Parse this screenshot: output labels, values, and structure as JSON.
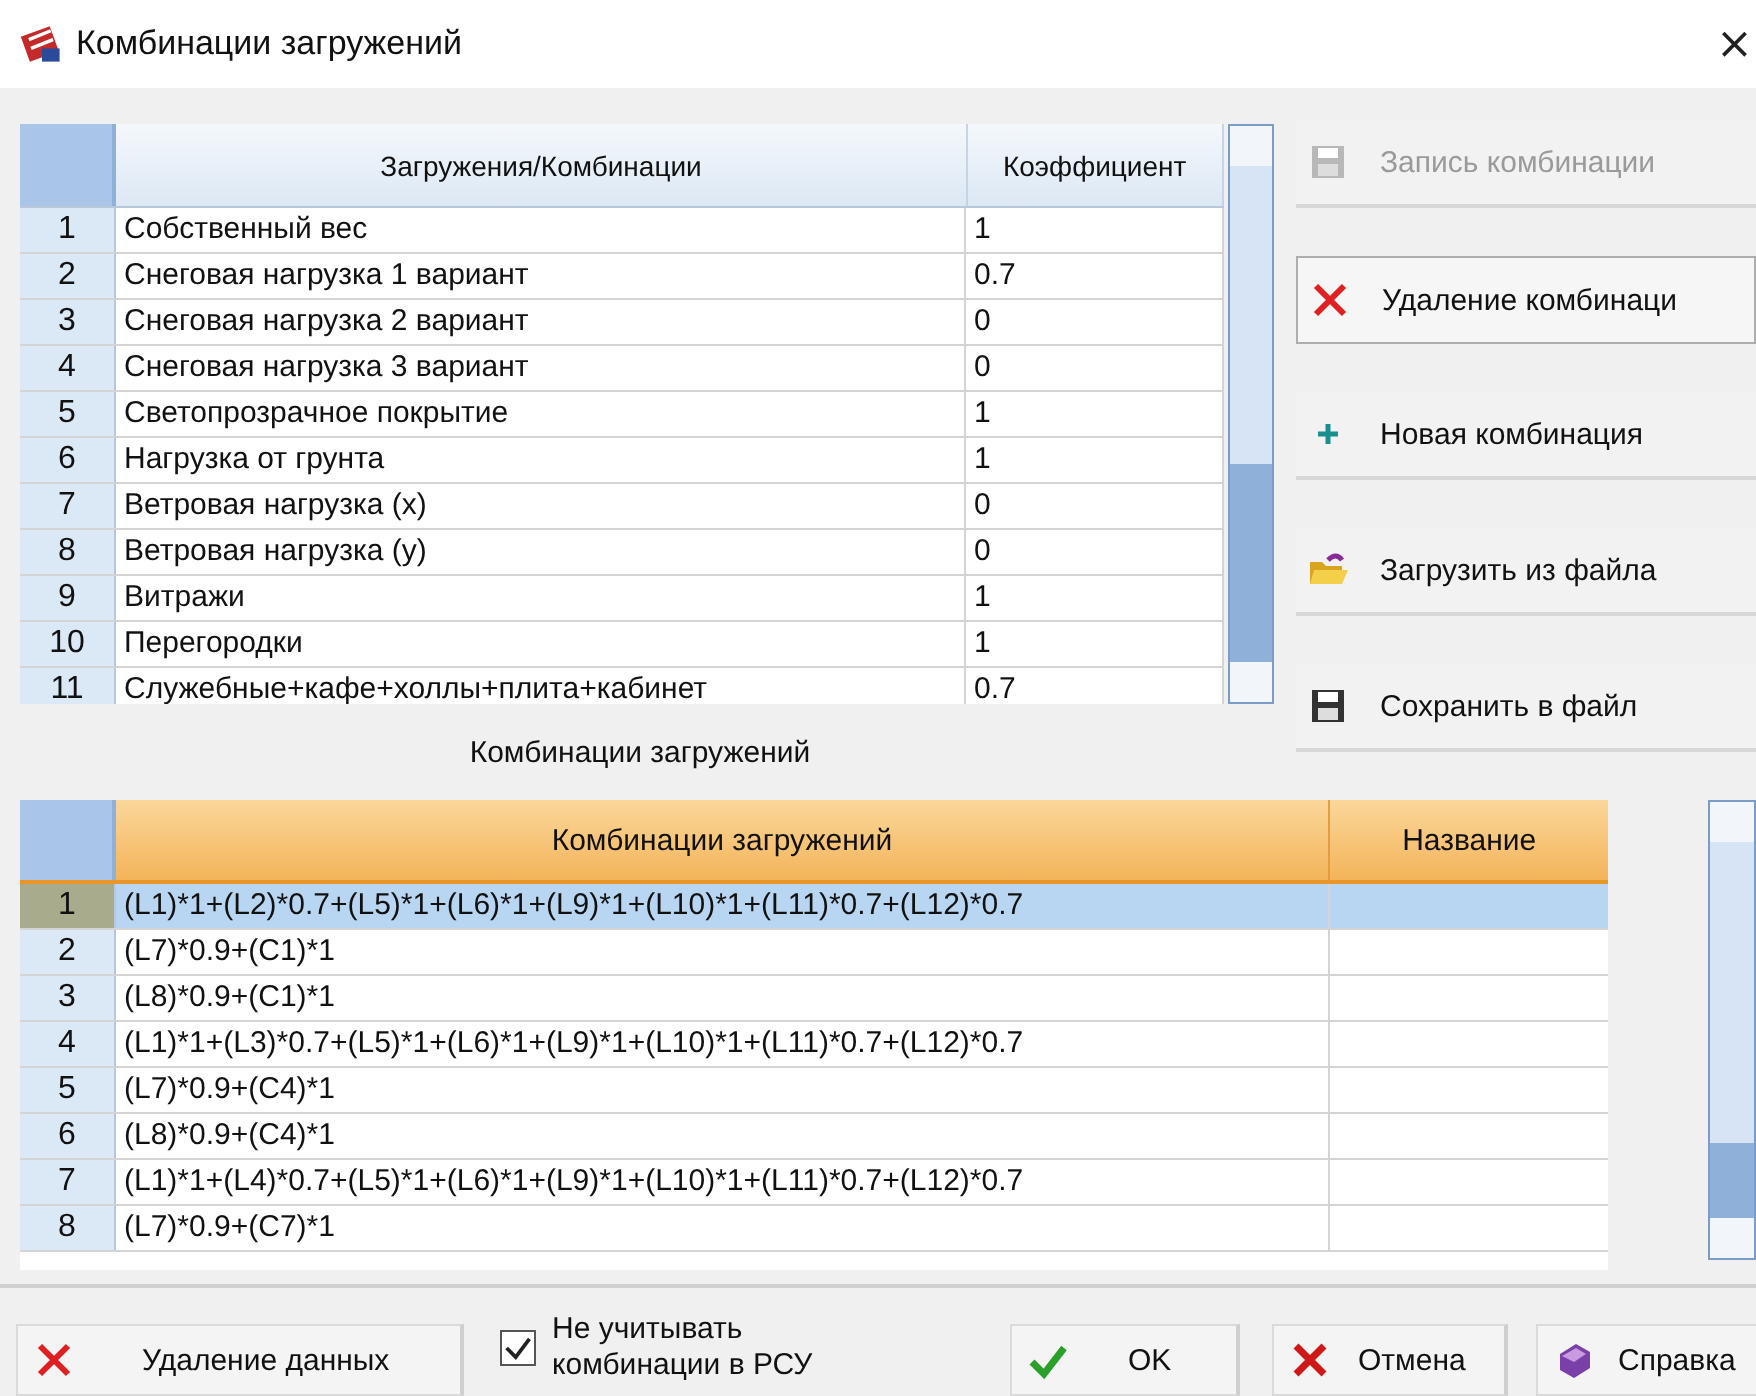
{
  "window": {
    "title": "Комбинации загружений",
    "close": "×"
  },
  "loads_table": {
    "columns": [
      "Загружения/Комбинации",
      "Коэффициент"
    ],
    "rows": [
      {
        "num": "1",
        "name": "Собственный вес",
        "factor": "1"
      },
      {
        "num": "2",
        "name": "Снеговая нагрузка 1 вариант",
        "factor": "0.7"
      },
      {
        "num": "3",
        "name": "Снеговая нагрузка 2 вариант",
        "factor": "0"
      },
      {
        "num": "4",
        "name": "Снеговая нагрузка 3 вариант",
        "factor": "0"
      },
      {
        "num": "5",
        "name": "Светопрозрачное покрытие",
        "factor": "1"
      },
      {
        "num": "6",
        "name": "Нагрузка от грунта",
        "factor": "1"
      },
      {
        "num": "7",
        "name": "Ветровая нагрузка (x)",
        "factor": "0"
      },
      {
        "num": "8",
        "name": "Ветровая нагрузка (y)",
        "factor": "0"
      },
      {
        "num": "9",
        "name": "Витражи",
        "factor": "1"
      },
      {
        "num": "10",
        "name": "Перегородки",
        "factor": "1"
      },
      {
        "num": "11",
        "name": "Служебные+кафе+холлы+плита+кабинет",
        "factor": "0.7"
      }
    ]
  },
  "side_buttons": [
    {
      "label": "Запись комбинации",
      "kind": "save",
      "disabled": true
    },
    {
      "label": "Удаление комбинаци",
      "kind": "delete",
      "disabled": false
    },
    {
      "label": "Новая комбинация",
      "kind": "new",
      "disabled": false
    },
    {
      "label": "Загрузить из файла",
      "kind": "open",
      "disabled": false
    },
    {
      "label": "Сохранить в файл",
      "kind": "save",
      "disabled": false
    }
  ],
  "combinations": {
    "caption": "Комбинации загружений",
    "columns": [
      "Комбинации загружений",
      "Название"
    ],
    "rows": [
      {
        "num": "1",
        "formula": "(L1)*1+(L2)*0.7+(L5)*1+(L6)*1+(L9)*1+(L10)*1+(L11)*0.7+(L12)*0.7",
        "selected": true
      },
      {
        "num": "2",
        "formula": "(L7)*0.9+(C1)*1",
        "selected": false
      },
      {
        "num": "3",
        "formula": "(L8)*0.9+(C1)*1",
        "selected": false
      },
      {
        "num": "4",
        "formula": "(L1)*1+(L3)*0.7+(L5)*1+(L6)*1+(L9)*1+(L10)*1+(L11)*0.7+(L12)*0.7",
        "selected": false
      },
      {
        "num": "5",
        "formula": "(L7)*0.9+(C4)*1",
        "selected": false
      },
      {
        "num": "6",
        "formula": "(L8)*0.9+(C4)*1",
        "selected": false
      },
      {
        "num": "7",
        "formula": "(L1)*1+(L4)*0.7+(L5)*1+(L6)*1+(L9)*1+(L10)*1+(L11)*0.7+(L12)*0.7",
        "selected": false
      },
      {
        "num": "8",
        "formula": "(L7)*0.9+(C7)*1",
        "selected": false
      }
    ]
  },
  "footer": {
    "delete_button": {
      "label": "Удаление данных",
      "kind": "delete"
    },
    "checkbox": {
      "label": "Не учитывать комбинации в РСУ",
      "checked": true
    },
    "buttons": [
      {
        "label": "OK",
        "kind": "ok"
      },
      {
        "label": "Отмена",
        "kind": "cancel"
      },
      {
        "label": "Справка",
        "kind": "help"
      }
    ]
  }
}
